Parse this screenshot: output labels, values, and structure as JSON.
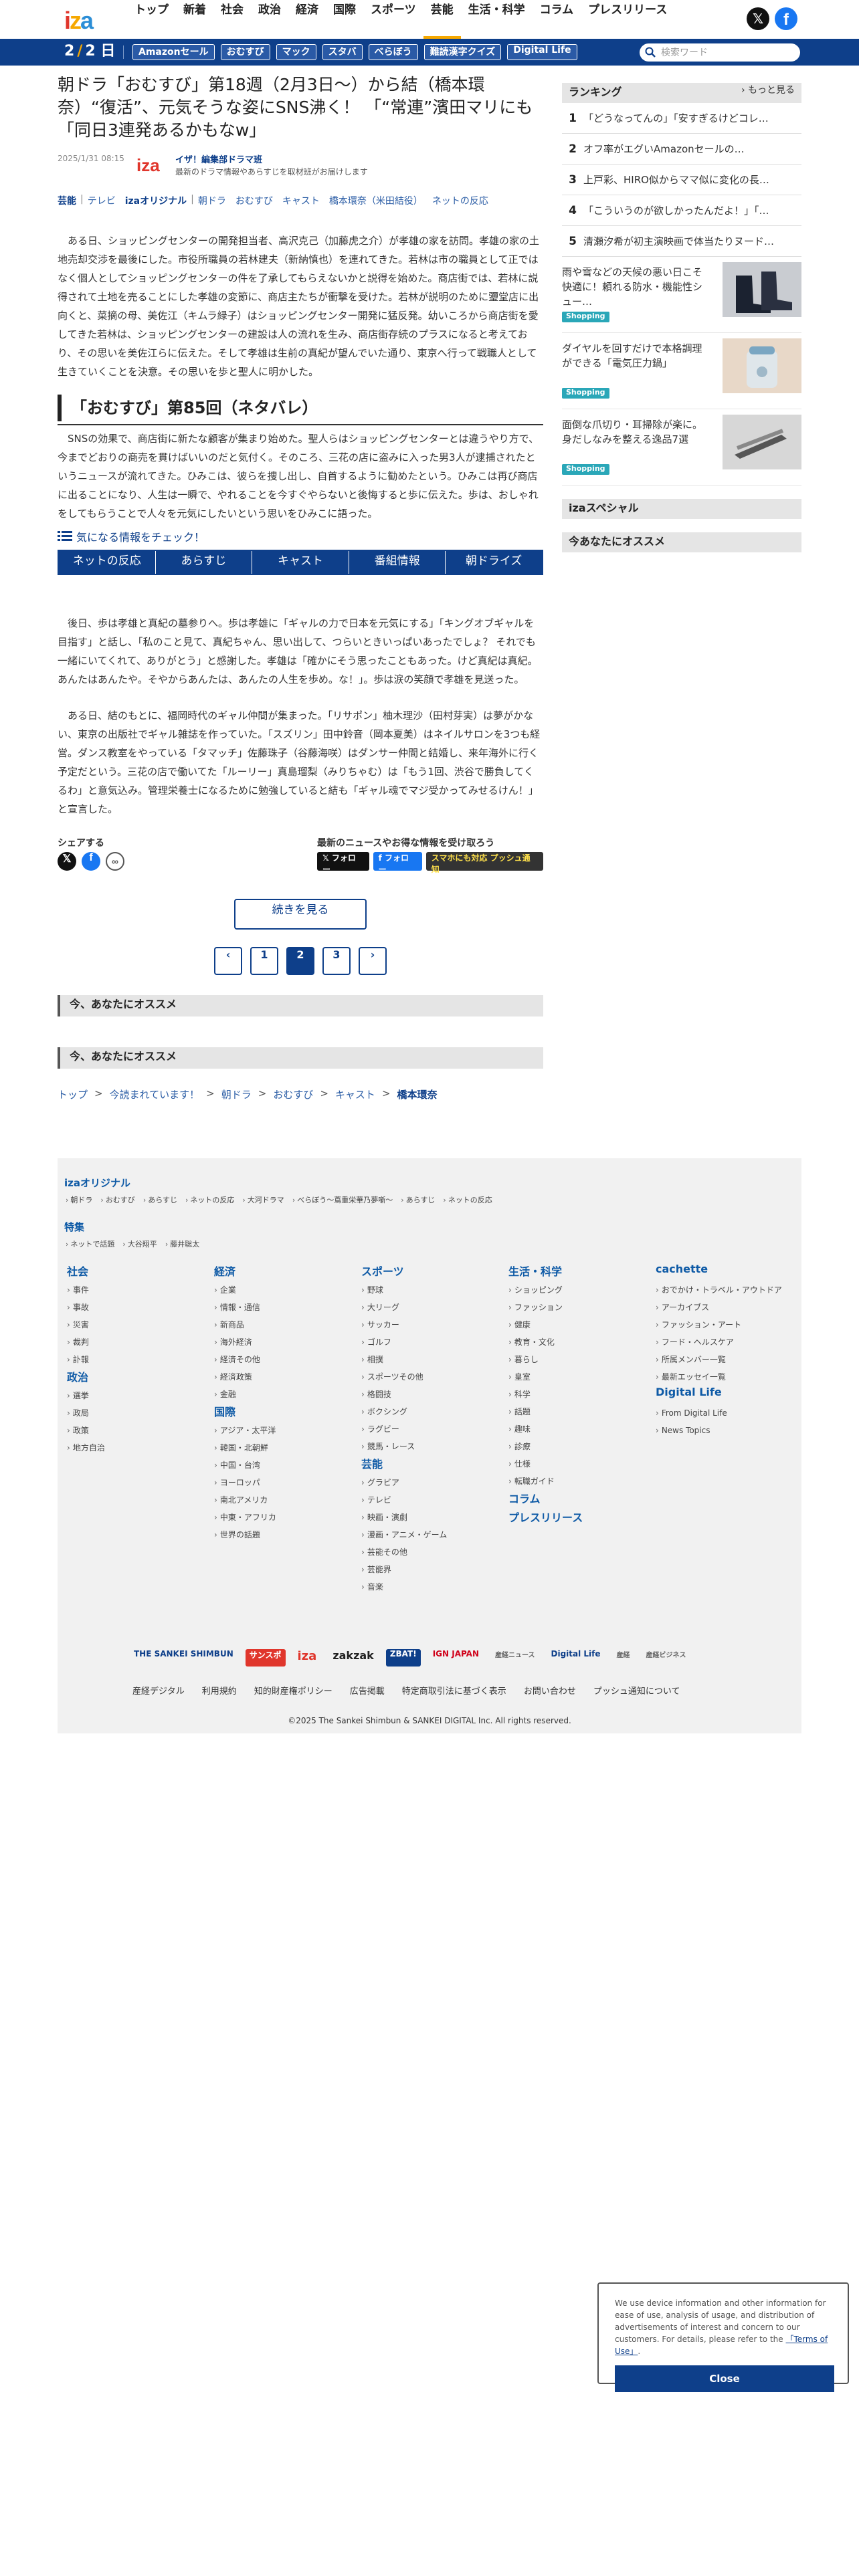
{
  "header": {
    "nav": [
      "トップ",
      "新着",
      "社会",
      "政治",
      "経済",
      "国際",
      "スポーツ",
      "芸能",
      "生活・科学",
      "コラム",
      "プレスリリース"
    ],
    "active_nav": "芸能"
  },
  "subbar": {
    "date_month": "2",
    "date_day": "2",
    "date_unit": "日",
    "tags": [
      "Amazonセール",
      "おむすび",
      "マック",
      "スタバ",
      "べらぼう",
      "難読漢字クイズ",
      "Digital Life"
    ],
    "search_placeholder": "検索ワード"
  },
  "article": {
    "title": "朝ドラ「おむすび」第18週（2月3日〜）から結（橋本環奈）“復活”、元気そうな姿にSNS沸く！ 「“常連”濱田マリにも「同日3連発あるかもなw」",
    "date": "2025/1/31 08:15",
    "author_name": "イザ！編集部ドラマ班",
    "author_desc": "最新のドラマ情報やあらすじを取材班がお届けします",
    "tags": [
      "芸能",
      "テレビ",
      "izaオリジナル",
      "朝ドラ",
      "おむすび",
      "キャスト",
      "橋本環奈（米田結役）",
      "ネットの反応"
    ],
    "lead": "ある日、ショッピングセンターの開発担当者、高沢克己（加藤虎之介）が孝雄の家を訪問。孝雄の家の土地売却交渉を最後にした。市役所職員の若林建夫（新納慎也）を連れてきた。若林は市の職員として正ではなく個人としてショッピングセンターの件を了承してもらえないかと説得を始めた。商店街では、若林に説得されて土地を売ることにした孝雄の変節に、商店主たちが衝撃を受けた。若林が説明のために瓕堂店に出向くと、菜摘の母、美佐江（キムラ緑子）はショッピングセンター開発に猛反発。幼いころから商店街を愛してきた若林は、ショッピングセンターの建設は人の流れを生み、商店街存続のプラスになると考えており、その思いを美佐江らに伝えた。そして孝雄は生前の真紀が望んでいた通り、東京へ行って戦職人として生きていくことを決意。その思いを歩と聖人に明かした。",
    "section_title": "「おむすび」第85回（ネタバレ）",
    "para1": "SNSの効果で、商店街に新たな顧客が集まり始めた。聖人らはショッピングセンターとは違うやり方で、今までどおりの商売を貫けばいいのだと気付く。そのころ、三花の店に盗みに入った男3人が逮捕されたというニュースが流れてきた。ひみこは、彼らを捜し出し、自首するように勧めたという。ひみこは再び商店に出ることになり、人生は一瞬で、やれることを今すぐやらないと後悔すると歩に伝えた。歩は、おしゃれをしてもらうことで人々を元気にしたいという思いをひみこに語った。",
    "checkout": "気になる情報をチェック！",
    "tabs": [
      "ネットの反応",
      "あらすじ",
      "キャスト",
      "番組情報",
      "朝ドライズ"
    ],
    "para2": "後日、歩は孝雄と真紀の墓参りへ。歩は孝雄に「ギャルの力で日本を元気にする」「キングオブギャルを目指す」と話し、「私のこと見て、真紀ちゃん、思い出して、つらいときいっぱいあったでしょ？ それでも一緒にいてくれて、ありがとう」と感謝した。孝雄は「確かにそう思ったこともあった。けど真紀は真紀。あんたはあんたや。そやからあんたは、あんたの人生を歩め。な！」。歩は涙の笑顔で孝雄を見送った。",
    "para3": "ある日、結のもとに、福岡時代のギャル仲間が集まった。「リサポン」柚木理沙（田村芽実）は夢がかない、東京の出版社でギャル雑誌を作っていた。「スズリン」田中鈴音（岡本夏美）はネイルサロンを3つも経営。ダンス教室をやっている「タマッチ」佐藤珠子（谷藤海咲）はダンサー仲間と結婚し、来年海外に行く予定だという。三花の店で働いてた「ルーリー」真島瑠梨（みりちゃむ）は「もう1回、渋谷で勝負してくるわ」と意気込み。管理栄養士になるために勉強していると結も「ギャル魂でマジ受かってみせるけん！」と宣言した。",
    "share_title": "シェアする",
    "follow_title": "最新のニュースやお得な情報を受け取ろう",
    "follow_x": "𝕏 フォロー",
    "follow_fb": "f フォロー",
    "follow_push": "スマホにも対応 プッシュ通知",
    "more_button": "続きを見る",
    "pages": [
      "‹",
      "1",
      "2",
      "3",
      "›"
    ],
    "current_page": "2",
    "recommend": "今、あなたにオススメ",
    "breadcrumb": [
      "トップ",
      "今読まれています！",
      "朝ドラ",
      "おむすび",
      "キャスト",
      "橋本環奈"
    ]
  },
  "sidebar": {
    "ranking_title": "ランキング",
    "ranking_more": "› もっと見る",
    "ranking": [
      "「どうなってんの」「安すぎるけどコレ…",
      "オフ率がエグいAmazonセールの…",
      "上戸彩、HIRO似からママ似に変化の長…",
      "「こういうのが欲しかったんだよ！」「…",
      "清瀬汐希が初主演映画で体当たりヌード…"
    ],
    "promos": [
      {
        "text": "雨や雪などの天候の悪い日こそ快適に！頼れる防水・機能性シュー…",
        "badge": "Shopping"
      },
      {
        "text": "ダイヤルを回すだけで本格調理ができる「電気圧力鍋」",
        "badge": "Shopping"
      },
      {
        "text": "面倒な爪切り・耳掃除が楽に。身だしなみを整える逸品7選",
        "badge": "Shopping"
      }
    ],
    "special": "izaスペシャル",
    "recommend": "今あなたにオススメ"
  },
  "footer": {
    "orig_title": "izaオリジナル",
    "orig_links": [
      "朝ドラ",
      "おむすび",
      "あらすじ",
      "ネットの反応",
      "大河ドラマ",
      "べらぼう〜蔦重栄華乃夢噺〜",
      "あらすじ",
      "ネットの反応"
    ],
    "special_title": "特集",
    "special_links": [
      "ネットで話題",
      "大谷翔平",
      "藤井聡太"
    ],
    "columns": [
      {
        "sections": [
          {
            "h": "社会",
            "items": [
              "事件",
              "事故",
              "災害",
              "裁判",
              "訃報"
            ]
          },
          {
            "h": "政治",
            "items": [
              "選挙",
              "政局",
              "政策",
              "地方自治"
            ]
          }
        ]
      },
      {
        "sections": [
          {
            "h": "経済",
            "items": [
              "企業",
              "情報・通信",
              "新商品",
              "海外経済",
              "経済その他",
              "経済政策",
              "金融"
            ]
          },
          {
            "h": "国際",
            "items": [
              "アジア・太平洋",
              "韓国・北朝鮮",
              "中国・台湾",
              "ヨーロッパ",
              "南北アメリカ",
              "中東・アフリカ",
              "世界の話題"
            ]
          }
        ]
      },
      {
        "sections": [
          {
            "h": "スポーツ",
            "items": [
              "野球",
              "大リーグ",
              "サッカー",
              "ゴルフ",
              "相撲",
              "スポーツその他",
              "格闘技",
              "ボクシング",
              "ラグビー",
              "競馬・レース"
            ]
          },
          {
            "h": "芸能",
            "items": [
              "グラビア",
              "テレビ",
              "映画・演劇",
              "漫画・アニメ・ゲーム",
              "芸能その他",
              "芸能界",
              "音楽"
            ]
          }
        ]
      },
      {
        "sections": [
          {
            "h": "生活・科学",
            "items": [
              "ショッピング",
              "ファッション",
              "健康",
              "教育・文化",
              "暮らし",
              "皇室",
              "科学",
              "話題",
              "趣味",
              "診療",
              "仕様",
              "転職ガイド"
            ]
          },
          {
            "h": "コラム",
            "items": []
          },
          {
            "h": "プレスリリース",
            "items": []
          }
        ]
      },
      {
        "sections": [
          {
            "h": "cachette",
            "items": [
              "おでかけ・トラベル・アウトドア",
              "アーカイブス",
              "ファッション・アート",
              "フード・ヘルスケア",
              "所属メンバー一覧",
              "最新エッセイ一覧"
            ]
          },
          {
            "h": "Digital Life",
            "items": [
              "From Digital Life",
              "News Topics"
            ]
          }
        ]
      }
    ],
    "brands": [
      "THE SANKEI SHIMBUN",
      "サンスポ",
      "iza",
      "zakzak",
      "ZBAT!",
      "IGN JAPAN",
      "産経ニュース",
      "Digital Life",
      "産経",
      "産経ビジネス"
    ],
    "legal": [
      "産経デジタル",
      "利用規約",
      "知的財産権ポリシー",
      "広告掲載",
      "特定商取引法に基づく表示",
      "お問い合わせ",
      "プッシュ通知について"
    ],
    "copyright": "©2025 The Sankei Shimbun & SANKEI DIGITAL Inc. All rights reserved."
  },
  "cookie": {
    "text": "We use device information and other information for ease of use, analysis of usage, and distribution of advertisements of interest and concern to our customers. For details, please refer to the",
    "link": "「Terms of Use」",
    "after": ".",
    "button": "Close"
  },
  "colors": {
    "brand_blue": "#0e3f8a",
    "accent_orange": "#f6a800",
    "badge_teal": "#2aa7b8"
  }
}
